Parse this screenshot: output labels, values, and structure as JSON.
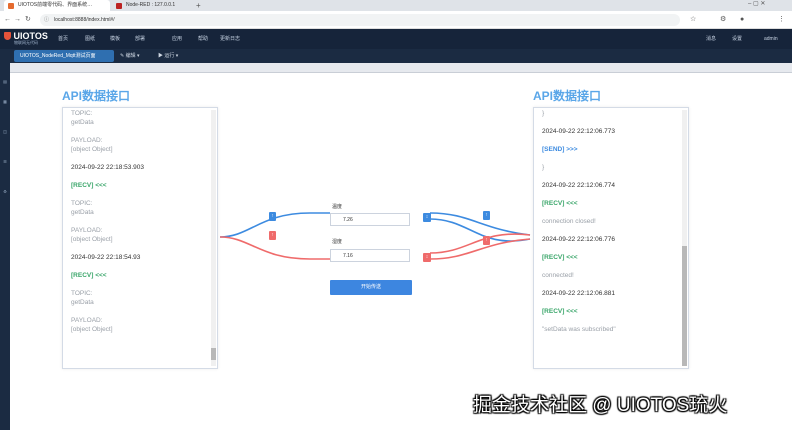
{
  "browser": {
    "tab1": "UIOTOS前端零代码、界面系统…",
    "tab2": "Node-RED : 127.0.0.1",
    "url": "localhost:8888/index.html#/"
  },
  "app": {
    "logo": "UIOTOS",
    "logo_sub": "物联网无代码",
    "menus": [
      "首页",
      "图纸",
      "模板",
      "部署",
      "应用",
      "帮助",
      "更新日志"
    ],
    "right_menus": [
      "消息",
      "设置",
      "admin"
    ]
  },
  "toolbar": {
    "file_tab": "UIOTOS_NodeRed_Mqtt测试页面",
    "items": [
      "编辑",
      "运行"
    ]
  },
  "left_panel": {
    "title": "API数据接口",
    "lines": [
      {
        "text": "TOPIC:",
        "cls": "c-meta"
      },
      {
        "text": "getData",
        "cls": "c-val"
      },
      {
        "text": "PAYLOAD:",
        "cls": "c-meta"
      },
      {
        "text": "[object Object]",
        "cls": "c-val"
      },
      {
        "text": "2024-09-22 22:18:53.903",
        "cls": "c-time"
      },
      {
        "text": "[RECV] <<<",
        "cls": "c-recv"
      },
      {
        "text": "TOPIC:",
        "cls": "c-meta"
      },
      {
        "text": "getData",
        "cls": "c-val"
      },
      {
        "text": "PAYLOAD:",
        "cls": "c-meta"
      },
      {
        "text": "[object Object]",
        "cls": "c-val"
      },
      {
        "text": "2024-09-22 22:18:54.93",
        "cls": "c-time"
      },
      {
        "text": "[RECV] <<<",
        "cls": "c-recv"
      },
      {
        "text": "TOPIC:",
        "cls": "c-meta"
      },
      {
        "text": "getData",
        "cls": "c-val"
      },
      {
        "text": "PAYLOAD:",
        "cls": "c-meta"
      },
      {
        "text": "[object Object]",
        "cls": "c-val"
      }
    ]
  },
  "right_panel": {
    "title": "API数据接口",
    "lines": [
      {
        "text": "}",
        "cls": "c-val"
      },
      {
        "text": "2024-09-22 22:12:06.773",
        "cls": "c-time"
      },
      {
        "text": "[SEND] >>>",
        "cls": "c-send"
      },
      {
        "text": "}",
        "cls": "c-val"
      },
      {
        "text": "2024-09-22 22:12:06.774",
        "cls": "c-time"
      },
      {
        "text": "[RECV] <<<",
        "cls": "c-recv"
      },
      {
        "text": "connection closed!",
        "cls": "c-val"
      },
      {
        "text": "2024-09-22 22:12:06.776",
        "cls": "c-time"
      },
      {
        "text": "[RECV] <<<",
        "cls": "c-recv"
      },
      {
        "text": "connected!",
        "cls": "c-val"
      },
      {
        "text": "2024-09-22 22:12:06.881",
        "cls": "c-time"
      },
      {
        "text": "[RECV] <<<",
        "cls": "c-recv"
      },
      {
        "text": "\"setData was subscribed\"",
        "cls": "c-val"
      }
    ]
  },
  "form": {
    "field1_label": "温度",
    "field1_value": "7.26",
    "field2_label": "湿度",
    "field2_value": "7.16",
    "send_button": "开始传送"
  },
  "watermark": "掘金技术社区 @ UIOTOS琉火",
  "colors": {
    "blue": "#3d8be0",
    "red": "#ef6b6b",
    "accent": "#5aa6e8"
  }
}
